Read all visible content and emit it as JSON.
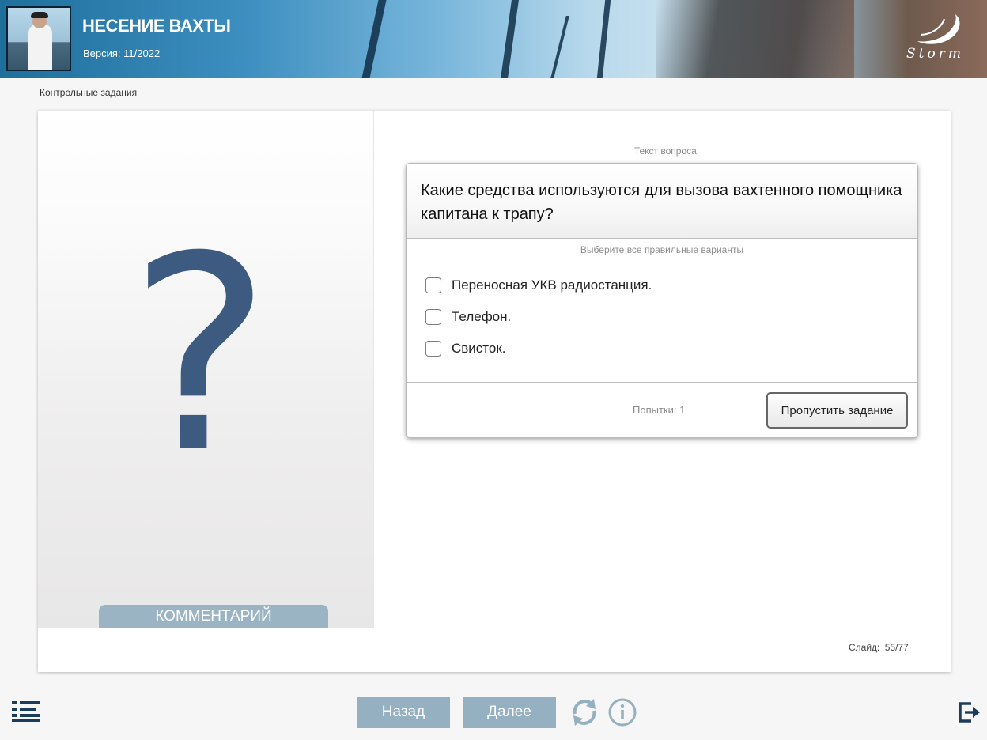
{
  "header": {
    "title": "НЕСЕНИЕ ВАХТЫ",
    "version": "Версия: 11/2022",
    "logo_text": "Storm"
  },
  "section_label": "Контрольные задания",
  "left_panel": {
    "symbol": "?",
    "comment_tab": "КОММЕНТАРИЙ"
  },
  "question": {
    "caption": "Текст вопроса:",
    "text": "Какие средства используются для вызова вахтенного помощника капитана к трапу?",
    "hint": "Выберите все правильные варианты",
    "options": [
      {
        "label": "Переносная УКВ радиостанция.",
        "checked": false
      },
      {
        "label": "Телефон.",
        "checked": false
      },
      {
        "label": "Свисток.",
        "checked": false
      }
    ],
    "attempts": "Попытки: 1",
    "skip_label": "Пропустить задание"
  },
  "slide_counter": "Слайд: 55/77",
  "nav": {
    "back_label": "Назад",
    "next_label": "Далее"
  },
  "icons": {
    "menu": "list-menu-icon",
    "reload": "reload-icon",
    "info": "info-icon",
    "exit": "exit-icon"
  },
  "colors": {
    "accent": "#3d5a80",
    "nav_button": "#94b0c1",
    "comment_tab": "#9bb4c4",
    "icon_dark": "#1c3d5a"
  }
}
